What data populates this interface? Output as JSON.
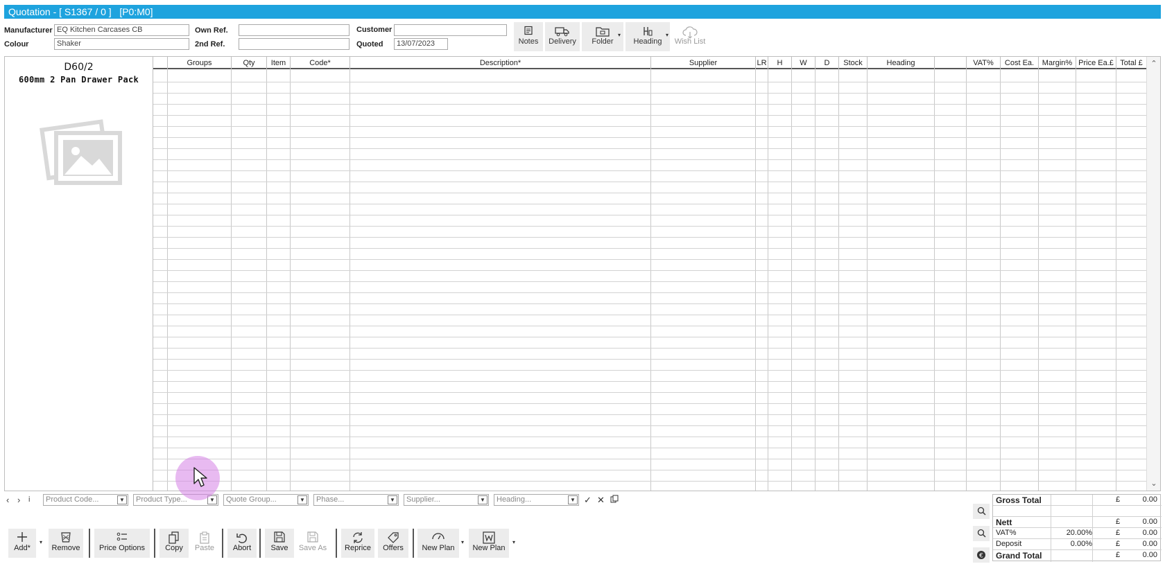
{
  "window": {
    "title": "Quotation - [ S1367 / 0 ]   [P0:M0]"
  },
  "header": {
    "manufacturer_label": "Manufacturer",
    "manufacturer_value": "EQ Kitchen Carcases CB",
    "colour_label": "Colour",
    "colour_value": "Shaker",
    "own_ref_label": "Own Ref.",
    "own_ref_value": "",
    "second_ref_label": "2nd Ref.",
    "second_ref_value": "",
    "customer_label": "Customer",
    "customer_value": "",
    "quoted_label": "Quoted",
    "quoted_value": "13/07/2023"
  },
  "toolbar": {
    "notes": "Notes",
    "delivery": "Delivery",
    "folder": "Folder",
    "heading": "Heading",
    "wish_list": "Wish List"
  },
  "product": {
    "code": "D60/2",
    "description": "600mm 2 Pan Drawer Pack"
  },
  "grid": {
    "columns": [
      "",
      "Groups",
      "Qty",
      "Item",
      "Code*",
      "Description*",
      "Supplier",
      "LR",
      "H",
      "W",
      "D",
      "Stock",
      "Heading",
      "",
      "VAT%",
      "Cost Ea.",
      "Margin%",
      "Price Ea.£",
      "Total £"
    ],
    "rows": []
  },
  "filters": {
    "product_code": "Product Code...",
    "product_type": "Product Type...",
    "quote_group": "Quote Group...",
    "phase": "Phase...",
    "supplier": "Supplier...",
    "heading": "Heading...",
    "info_glyph": "i"
  },
  "bottom_toolbar": {
    "add": "Add*",
    "remove": "Remove",
    "price_options": "Price Options",
    "copy": "Copy",
    "paste": "Paste",
    "abort": "Abort",
    "save": "Save",
    "save_as": "Save As",
    "reprice": "Reprice",
    "offers": "Offers",
    "new_plan_1": "New Plan",
    "new_plan_2": "New Plan"
  },
  "totals": {
    "gross_total_label": "Gross Total",
    "gross_total_currency": "£",
    "gross_total_value": "0.00",
    "nett_label": "Nett",
    "nett_currency": "£",
    "nett_value": "0.00",
    "vat_label": "VAT%",
    "vat_rate": "20.00%",
    "vat_currency": "£",
    "vat_value": "0.00",
    "deposit_label": "Deposit",
    "deposit_rate": "0.00%",
    "deposit_currency": "£",
    "deposit_value": "0.00",
    "grand_total_label": "Grand Total",
    "grand_total_currency": "£",
    "grand_total_value": "0.00"
  },
  "colors": {
    "title_bar": "#1ea3de",
    "button_bg": "#ececec",
    "cursor_highlight": "#d682e6"
  }
}
